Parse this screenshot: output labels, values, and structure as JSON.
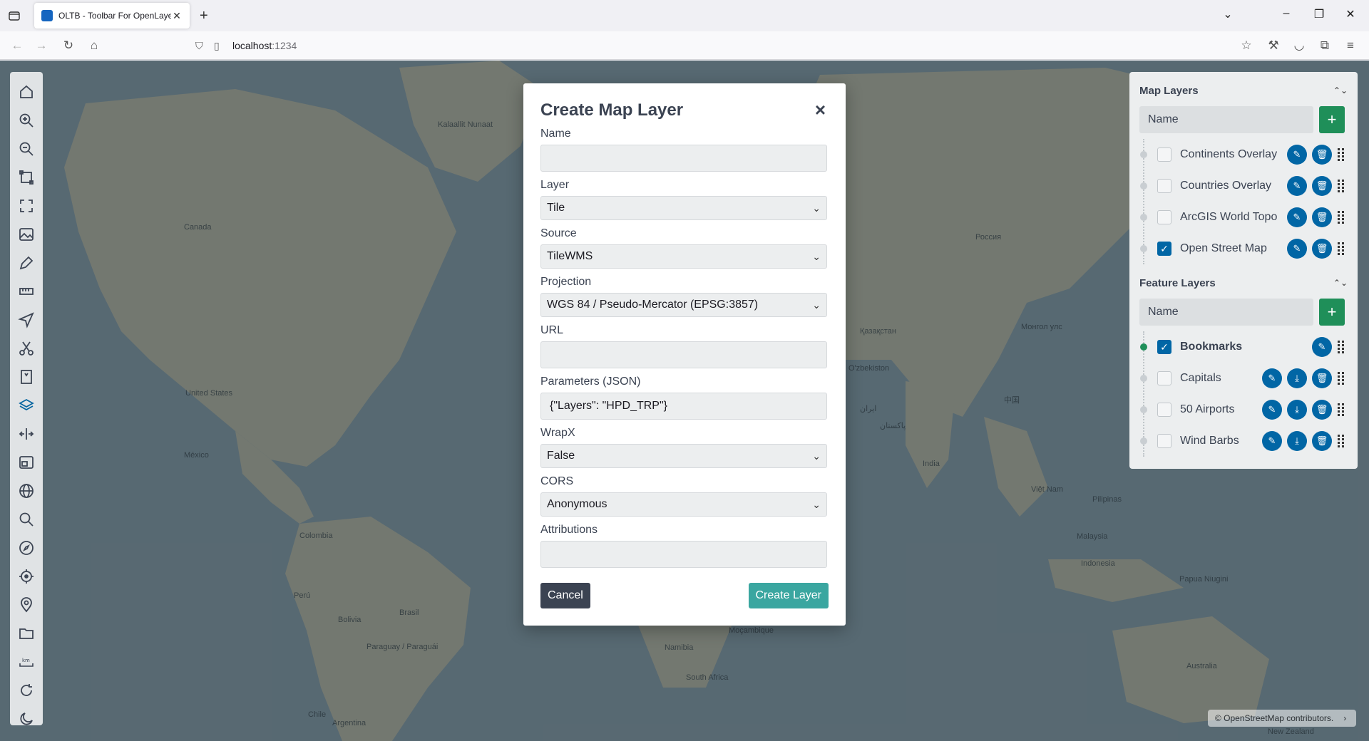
{
  "browser": {
    "tab_title": "OLTB - Toolbar For OpenLayers",
    "url_host": "localhost",
    "url_port": ":1234"
  },
  "map_labels": [
    {
      "text": "Kalaallit Nunaat"
    },
    {
      "text": "Canada"
    },
    {
      "text": "United States"
    },
    {
      "text": "México"
    },
    {
      "text": "Colombia"
    },
    {
      "text": "Perú"
    },
    {
      "text": "Brasil"
    },
    {
      "text": "Bolivia"
    },
    {
      "text": "Paraguay / Paraguái"
    },
    {
      "text": "Chile"
    },
    {
      "text": "Argentina"
    },
    {
      "text": "Россия"
    },
    {
      "text": "Қазақстан"
    },
    {
      "text": "Монгол улс"
    },
    {
      "text": "O'zbekiston"
    },
    {
      "text": "ایران"
    },
    {
      "text": "پاکستان"
    },
    {
      "text": "India"
    },
    {
      "text": "中国"
    },
    {
      "text": "Việt Nam"
    },
    {
      "text": "Pilipinas"
    },
    {
      "text": "Malaysia"
    },
    {
      "text": "Indonesia"
    },
    {
      "text": "Papua Niugini"
    },
    {
      "text": "Australia"
    },
    {
      "text": "New Zealand"
    },
    {
      "text": "Namibia"
    },
    {
      "text": "South Africa"
    },
    {
      "text": "Moçambique"
    }
  ],
  "modal": {
    "title": "Create Map Layer",
    "close": "×",
    "fields": {
      "name": {
        "label": "Name",
        "value": ""
      },
      "layer": {
        "label": "Layer",
        "value": "Tile"
      },
      "source": {
        "label": "Source",
        "value": "TileWMS"
      },
      "projection": {
        "label": "Projection",
        "value": "WGS 84 / Pseudo-Mercator (EPSG:3857)"
      },
      "url": {
        "label": "URL",
        "value": ""
      },
      "parameters": {
        "label": "Parameters (JSON)",
        "value": "{\"Layers\": \"HPD_TRP\"}"
      },
      "wrapx": {
        "label": "WrapX",
        "value": "False"
      },
      "cors": {
        "label": "CORS",
        "value": "Anonymous"
      },
      "attributions": {
        "label": "Attributions",
        "value": ""
      }
    },
    "cancel": "Cancel",
    "create": "Create Layer"
  },
  "layers_panel": {
    "map_layers": {
      "title": "Map Layers",
      "name_placeholder": "Name",
      "add": "+",
      "items": [
        {
          "name": "Continents Overlay",
          "checked": false
        },
        {
          "name": "Countries Overlay",
          "checked": false
        },
        {
          "name": "ArcGIS World Topo",
          "checked": false
        },
        {
          "name": "Open Street Map",
          "checked": true
        }
      ]
    },
    "feature_layers": {
      "title": "Feature Layers",
      "name_placeholder": "Name",
      "add": "+",
      "items": [
        {
          "name": "Bookmarks",
          "checked": true,
          "active": true
        },
        {
          "name": "Capitals",
          "checked": false
        },
        {
          "name": "50 Airports",
          "checked": false
        },
        {
          "name": "Wind Barbs",
          "checked": false
        }
      ]
    }
  },
  "attribution": "© OpenStreetMap contributors.",
  "icons": {
    "toolbar": [
      "home-icon",
      "zoom-in-icon",
      "zoom-out-icon",
      "full-extent-icon",
      "fullscreen-icon",
      "export-png-icon",
      "draw-icon",
      "measure-icon",
      "direction-icon",
      "split-view-icon",
      "bookmark-icon",
      "layers-icon",
      "split-icon",
      "overview-icon",
      "graticule-icon",
      "magnify-icon",
      "compass-icon",
      "my-location-icon",
      "marker-icon",
      "import-icon",
      "scale-line-icon",
      "refresh-icon",
      "theme-icon"
    ]
  },
  "colors": {
    "accent": "#0166a5",
    "add_button": "#1f8f59",
    "create_button": "#3aa6a0",
    "cancel_button": "#3b4352",
    "ocean": "#667a84",
    "land": "#8c8f82"
  }
}
